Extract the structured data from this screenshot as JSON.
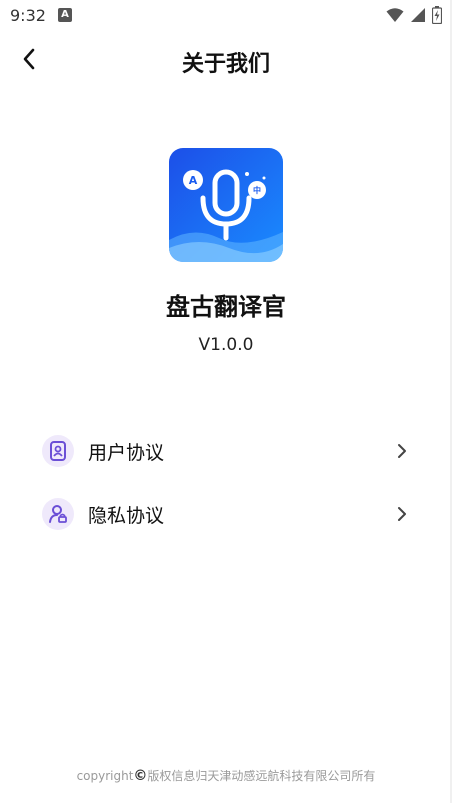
{
  "status_bar": {
    "time": "9:32",
    "notification_icon": "A",
    "icons": [
      "wifi-icon",
      "signal-icon",
      "battery-icon"
    ]
  },
  "header": {
    "title": "关于我们",
    "back_icon": "chevron-left-icon"
  },
  "app": {
    "name": "盘古翻译官",
    "version": "V1.0.0",
    "logo_bubble_left": "A",
    "logo_bubble_right": "中",
    "colors": {
      "logo_blue": "#1565f5",
      "logo_light": "#4fb0ff"
    }
  },
  "menu": [
    {
      "label": "用户协议",
      "icon": "user-agreement-icon"
    },
    {
      "label": "隐私协议",
      "icon": "privacy-icon"
    }
  ],
  "footer": {
    "prefix": "copyright",
    "symbol": "©",
    "text": "版权信息归天津动感远航科技有限公司所有"
  },
  "colors": {
    "accent": "#6b4fd6",
    "icon_bg": "#efe9fb"
  }
}
